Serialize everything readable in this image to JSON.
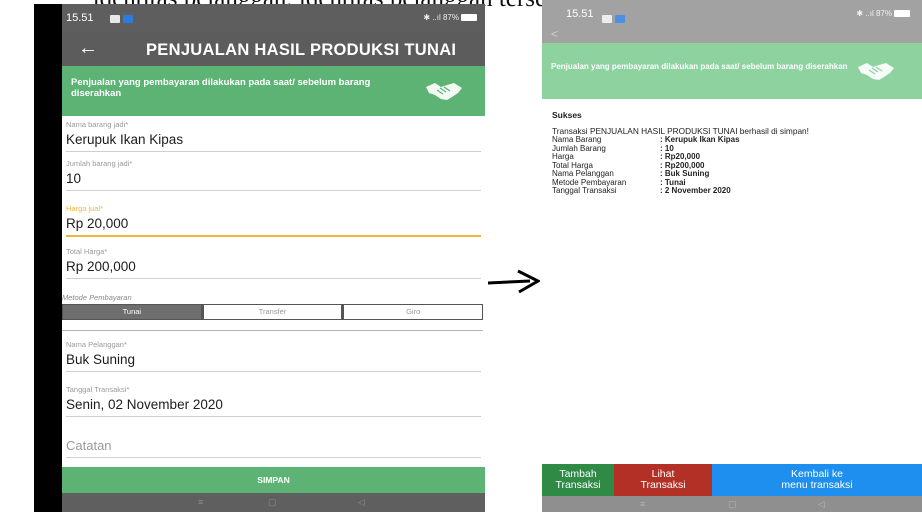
{
  "caption": "identitas pelanggan, identitas pelanggan tersebut ada pada data pelanggan",
  "left_screen": {
    "status": {
      "time": "15.51",
      "battery": "87%"
    },
    "appbar": {
      "back_icon": "arrow-left-icon",
      "title": "PENJUALAN HASIL PRODUKSI TUNAI"
    },
    "banner": {
      "text": "Penjualan yang pembayaran dilakukan pada saat/ sebelum barang diserahkan",
      "icon": "handshake-icon"
    },
    "fields": {
      "nama_barang": {
        "label": "Nama barang jadi*",
        "value": "Kerupuk Ikan Kipas"
      },
      "jumlah_barang": {
        "label": "Jumlah barang jadi*",
        "value": "10"
      },
      "harga_jual": {
        "label": "Harga jual*",
        "value": "Rp 20,000"
      },
      "total_harga": {
        "label": "Total Harga*",
        "value": "Rp 200,000"
      },
      "nama_pelanggan": {
        "label": "Nama Pelanggan*",
        "value": "Buk Suning"
      },
      "tanggal_transaksi": {
        "label": "Tanggal Transaksi*",
        "value": "Senin, 02 November 2020"
      },
      "catatan": {
        "placeholder": "Catatan"
      }
    },
    "metode_pembayaran": {
      "label": "Metode Pembayaran",
      "options": [
        "Tunai",
        "Transfer",
        "Giro"
      ],
      "selected": "Tunai"
    },
    "simpan_label": "SIMPAN",
    "colors": {
      "appbar": "#5c5c5c",
      "accent_green": "#5db374",
      "focus_orange": "#f0b640"
    }
  },
  "right_screen": {
    "status": {
      "time": "15.51",
      "battery": "87%"
    },
    "banner": {
      "text": "Penjualan yang pembayaran dilakukan pada saat/ sebelum barang diserahkan",
      "icon": "handshake-icon"
    },
    "dialog": {
      "title": "Sukses",
      "message": "Transaksi PENJUALAN HASIL PRODUKSI TUNAI berhasil di simpan!",
      "rows": [
        {
          "key": "Nama Barang",
          "value": ": Kerupuk Ikan Kipas"
        },
        {
          "key": "Jumlah Barang",
          "value": ": 10"
        },
        {
          "key": "Harga",
          "value": ": Rp20,000"
        },
        {
          "key": "Total Harga",
          "value": ": Rp200,000"
        },
        {
          "key": "Nama Pelanggan",
          "value": ": Buk Suning"
        },
        {
          "key": "Metode Pembayaran",
          "value": ": Tunai"
        },
        {
          "key": "Tanggal Transaksi",
          "value": ": 2 November 2020"
        }
      ]
    },
    "buttons": [
      {
        "line1": "Tambah",
        "line2": "Transaksi",
        "color": "#2f8a46"
      },
      {
        "line1": "Lihat",
        "line2": "Transaksi",
        "color": "#b23026"
      },
      {
        "line1": "Kembali ke",
        "line2": "menu transaksi",
        "color": "#1f8fef"
      }
    ]
  }
}
